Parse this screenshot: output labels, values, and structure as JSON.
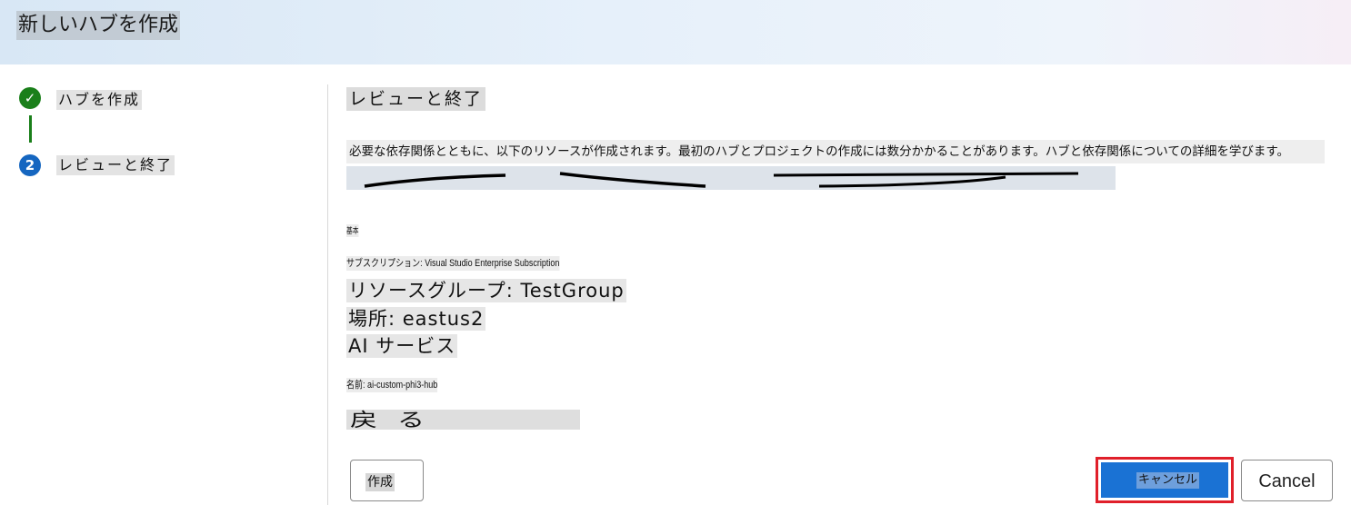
{
  "header": {
    "title": "新しいハブを作成"
  },
  "steps": [
    {
      "number": "✓",
      "label": "ハブを作成"
    },
    {
      "number": "2",
      "label": "レビューと終了"
    }
  ],
  "main": {
    "title": "レビューと終了",
    "description": "必要な依存関係とともに、以下のリソースが作成されます。最初のハブとプロジェクトの作成には数分かかることがあります。ハブと依存関係についての詳細を学びます。",
    "basics_label": "基本",
    "subscription": "サブスクリプション: Visual Studio Enterprise Subscription",
    "resource_group": "リソースグループ: TestGroup",
    "location": "場所: eastus2",
    "ai_services": "AI サービス",
    "name": "名前: ai-custom-phi3-hub",
    "back": "戻る"
  },
  "footer": {
    "create_label": "作成",
    "cancel_ja_label": "キャンセル",
    "cancel_label": "Cancel"
  },
  "colors": {
    "step_done": "#1a7f1a",
    "step_active": "#1566c0",
    "primary_button": "#1a72d4",
    "highlight_border": "#e0202a"
  }
}
